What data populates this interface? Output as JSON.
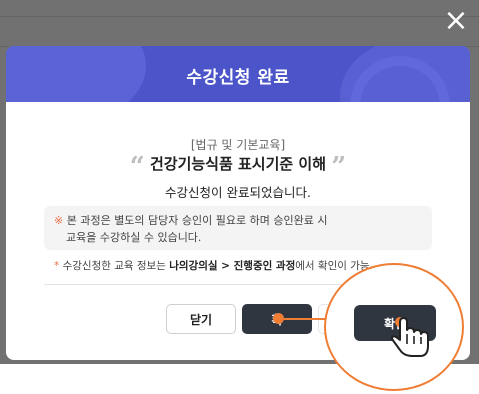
{
  "close_icon": "×",
  "modal": {
    "title": "수강신청 완료",
    "category": "[법규 및 기본교육]",
    "course_title": "건강기능식품 표시기준 이해",
    "quote_open": "“",
    "quote_close": "”",
    "done_message": "수강신청이 완료되었습니다.",
    "notice": {
      "marker": "※",
      "line1": "본 과정은 별도의 담당자 승인이 필요로 하며 승인완료 시",
      "line2": "교육을 수강하실 수 있습니다."
    },
    "info": {
      "marker": "*",
      "prefix": "수강신청한 교육 정보는",
      "bold": "나의강의실 > 진행중인 과정",
      "suffix": "에서 확인이 가능"
    },
    "buttons": {
      "close": "닫기",
      "confirm": "확인",
      "confirm_partial": "확"
    }
  },
  "zoom": {
    "button_label": "확인"
  },
  "colors": {
    "header": "#4b55c9",
    "accent": "#ef7d34",
    "dark_button": "#2f3640"
  }
}
